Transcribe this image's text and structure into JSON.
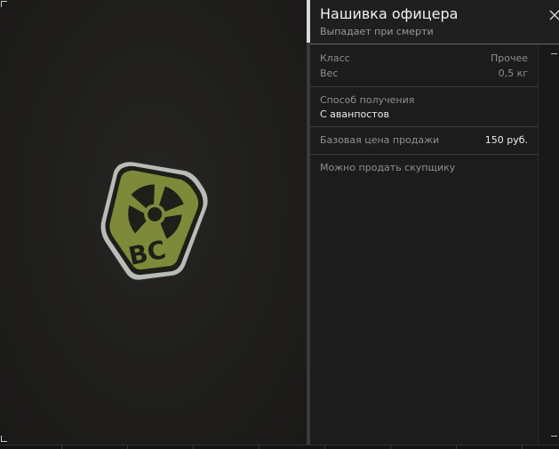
{
  "item": {
    "title": "Нашивка офицера",
    "subtitle": "Выпадает при смерти",
    "patch_text": "BC"
  },
  "stats": {
    "class_label": "Класс",
    "class_value": "Прочее",
    "weight_label": "Вес",
    "weight_value": "0,5 кг",
    "acquire_label": "Способ получения",
    "acquire_value": "С аванпостов",
    "price_label": "Базовая цена продажи",
    "price_value": "150 руб.",
    "note": "Можно продать скупщику"
  },
  "icons": {
    "close": "close-icon",
    "patch": "radiation-patch-icon"
  },
  "colors": {
    "patch_olive": "#7e8a3a",
    "patch_dark": "#1d1f18",
    "panel_bg": "#1b1b1b",
    "accent_light": "#d9d9d9"
  }
}
